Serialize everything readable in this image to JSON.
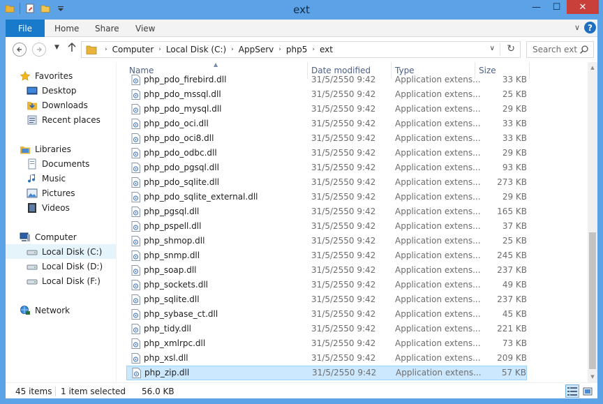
{
  "window": {
    "title": "ext",
    "controls": {
      "minimize": "—",
      "maximize": "☐",
      "close": "✕"
    }
  },
  "ribbon": {
    "tabs": [
      {
        "label": "File"
      },
      {
        "label": "Home"
      },
      {
        "label": "Share"
      },
      {
        "label": "View"
      }
    ],
    "help": "?"
  },
  "address": {
    "crumbs": [
      "Computer",
      "Local Disk (C:)",
      "AppServ",
      "php5",
      "ext"
    ],
    "separator": "›"
  },
  "search": {
    "placeholder": "Search ext"
  },
  "nav": {
    "favorites": {
      "label": "Favorites",
      "items": [
        {
          "label": "Desktop",
          "icon": "desktop-icon"
        },
        {
          "label": "Downloads",
          "icon": "downloads-icon"
        },
        {
          "label": "Recent places",
          "icon": "recent-places-icon"
        }
      ]
    },
    "libraries": {
      "label": "Libraries",
      "items": [
        {
          "label": "Documents",
          "icon": "documents-icon"
        },
        {
          "label": "Music",
          "icon": "music-icon"
        },
        {
          "label": "Pictures",
          "icon": "pictures-icon"
        },
        {
          "label": "Videos",
          "icon": "videos-icon"
        }
      ]
    },
    "computer": {
      "label": "Computer",
      "items": [
        {
          "label": "Local Disk (C:)",
          "icon": "drive-icon",
          "selected": true
        },
        {
          "label": "Local Disk (D:)",
          "icon": "drive-icon"
        },
        {
          "label": "Local Disk (F:)",
          "icon": "drive-icon"
        }
      ]
    },
    "network": {
      "label": "Network"
    }
  },
  "columns": {
    "name": "Name",
    "date": "Date modified",
    "type": "Type",
    "size": "Size"
  },
  "files": [
    {
      "name": "php_pdo_firebird.dll",
      "date": "31/5/2550 9:42",
      "type": "Application extens...",
      "size": "33 KB"
    },
    {
      "name": "php_pdo_mssql.dll",
      "date": "31/5/2550 9:42",
      "type": "Application extens...",
      "size": "25 KB"
    },
    {
      "name": "php_pdo_mysql.dll",
      "date": "31/5/2550 9:42",
      "type": "Application extens...",
      "size": "29 KB"
    },
    {
      "name": "php_pdo_oci.dll",
      "date": "31/5/2550 9:42",
      "type": "Application extens...",
      "size": "33 KB"
    },
    {
      "name": "php_pdo_oci8.dll",
      "date": "31/5/2550 9:42",
      "type": "Application extens...",
      "size": "33 KB"
    },
    {
      "name": "php_pdo_odbc.dll",
      "date": "31/5/2550 9:42",
      "type": "Application extens...",
      "size": "29 KB"
    },
    {
      "name": "php_pdo_pgsql.dll",
      "date": "31/5/2550 9:42",
      "type": "Application extens...",
      "size": "93 KB"
    },
    {
      "name": "php_pdo_sqlite.dll",
      "date": "31/5/2550 9:42",
      "type": "Application extens...",
      "size": "273 KB"
    },
    {
      "name": "php_pdo_sqlite_external.dll",
      "date": "31/5/2550 9:42",
      "type": "Application extens...",
      "size": "29 KB"
    },
    {
      "name": "php_pgsql.dll",
      "date": "31/5/2550 9:42",
      "type": "Application extens...",
      "size": "165 KB"
    },
    {
      "name": "php_pspell.dll",
      "date": "31/5/2550 9:42",
      "type": "Application extens...",
      "size": "37 KB"
    },
    {
      "name": "php_shmop.dll",
      "date": "31/5/2550 9:42",
      "type": "Application extens...",
      "size": "25 KB"
    },
    {
      "name": "php_snmp.dll",
      "date": "31/5/2550 9:42",
      "type": "Application extens...",
      "size": "245 KB"
    },
    {
      "name": "php_soap.dll",
      "date": "31/5/2550 9:42",
      "type": "Application extens...",
      "size": "237 KB"
    },
    {
      "name": "php_sockets.dll",
      "date": "31/5/2550 9:42",
      "type": "Application extens...",
      "size": "49 KB"
    },
    {
      "name": "php_sqlite.dll",
      "date": "31/5/2550 9:42",
      "type": "Application extens...",
      "size": "237 KB"
    },
    {
      "name": "php_sybase_ct.dll",
      "date": "31/5/2550 9:42",
      "type": "Application extens...",
      "size": "45 KB"
    },
    {
      "name": "php_tidy.dll",
      "date": "31/5/2550 9:42",
      "type": "Application extens...",
      "size": "221 KB"
    },
    {
      "name": "php_xmlrpc.dll",
      "date": "31/5/2550 9:42",
      "type": "Application extens...",
      "size": "73 KB"
    },
    {
      "name": "php_xsl.dll",
      "date": "31/5/2550 9:42",
      "type": "Application extens...",
      "size": "209 KB"
    },
    {
      "name": "php_zip.dll",
      "date": "31/5/2550 9:42",
      "type": "Application extens...",
      "size": "57 KB",
      "selected": true
    }
  ],
  "status": {
    "items_count": "45 items",
    "selected": "1 item selected",
    "selected_size": "56.0 KB"
  },
  "colors": {
    "title_bar": "#5ba3e6",
    "file_tab": "#1979ca",
    "close_button": "#c9403a",
    "selection": "#cce8ff",
    "column_header_text": "#4d6185"
  }
}
